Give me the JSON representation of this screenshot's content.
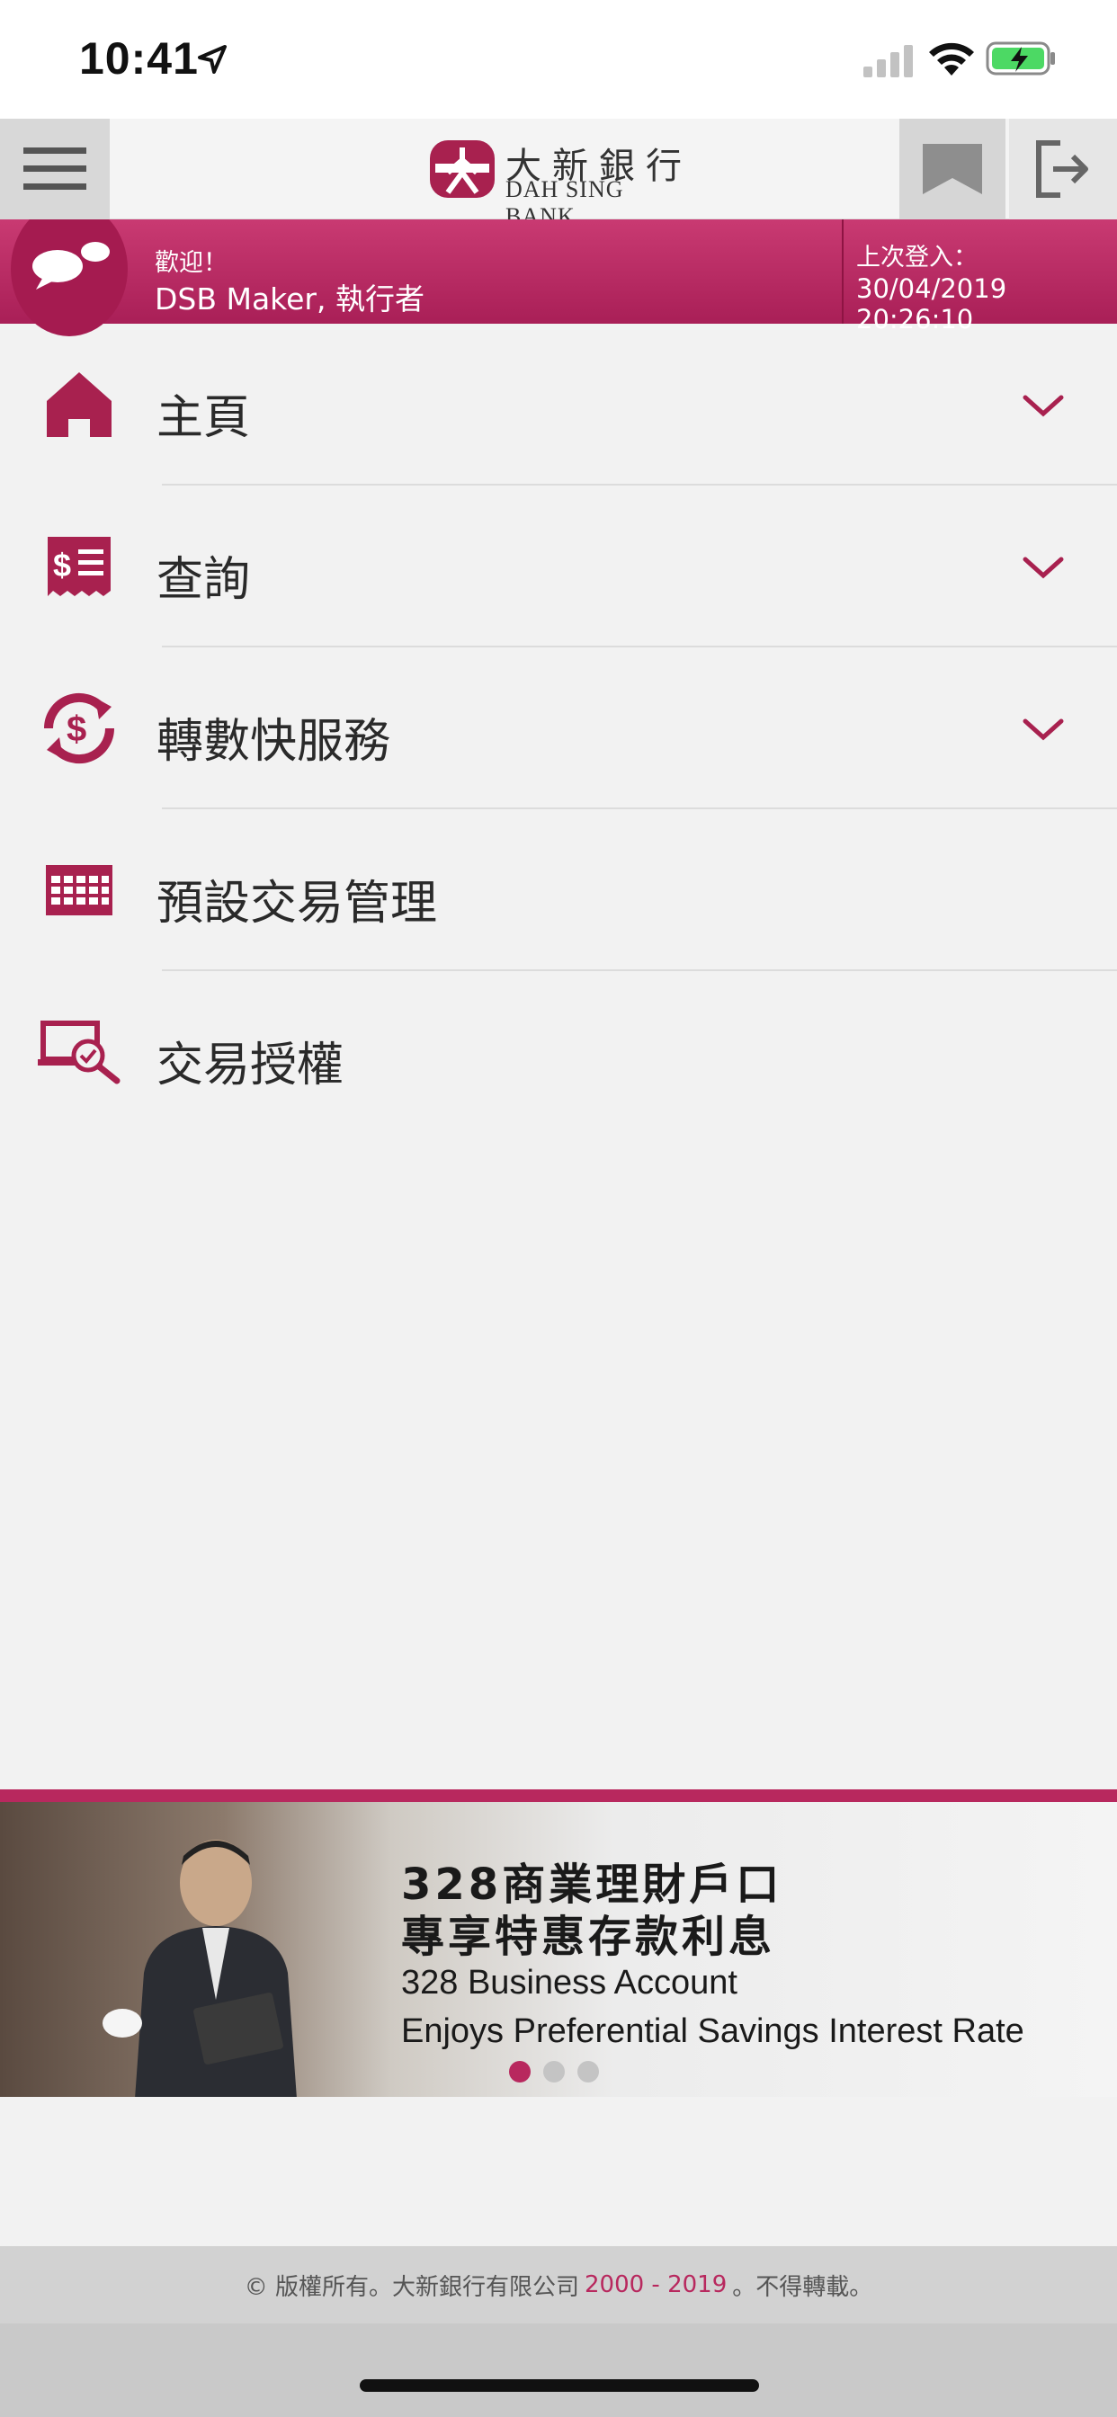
{
  "status_bar": {
    "time": "10:41"
  },
  "header": {
    "logo_chinese": "大新銀行",
    "logo_english": "DAH SING BANK"
  },
  "welcome": {
    "greeting": "歡迎！",
    "user": "DSB Maker, 執行者",
    "last_login_label": "上次登入：",
    "last_login_value": "30/04/2019 20:26:10"
  },
  "menu": {
    "items": [
      {
        "label": "主頁",
        "icon": "home-icon",
        "expandable": true
      },
      {
        "label": "查詢",
        "icon": "statement-icon",
        "expandable": true
      },
      {
        "label": "轉數快服務",
        "icon": "transfer-icon",
        "expandable": true
      },
      {
        "label": "預設交易管理",
        "icon": "calendar-icon",
        "expandable": false
      },
      {
        "label": "交易授權",
        "icon": "authorize-icon",
        "expandable": false
      }
    ]
  },
  "banner": {
    "title_cn_1": "328商業理財戶口",
    "title_cn_2": "專享特惠存款利息",
    "title_en_1": "328 Business Account",
    "title_en_2": "Enjoys Preferential Savings Interest Rate",
    "slides_total": 3,
    "active_slide": 1
  },
  "footer": {
    "prefix": "© 版權所有。大新銀行有限公司",
    "years": "2000 - 2019",
    "suffix": "。不得轉載。"
  },
  "colors": {
    "brand": "#b8285e",
    "welcome_bar": "#c93a72",
    "background": "#f2f2f2"
  }
}
